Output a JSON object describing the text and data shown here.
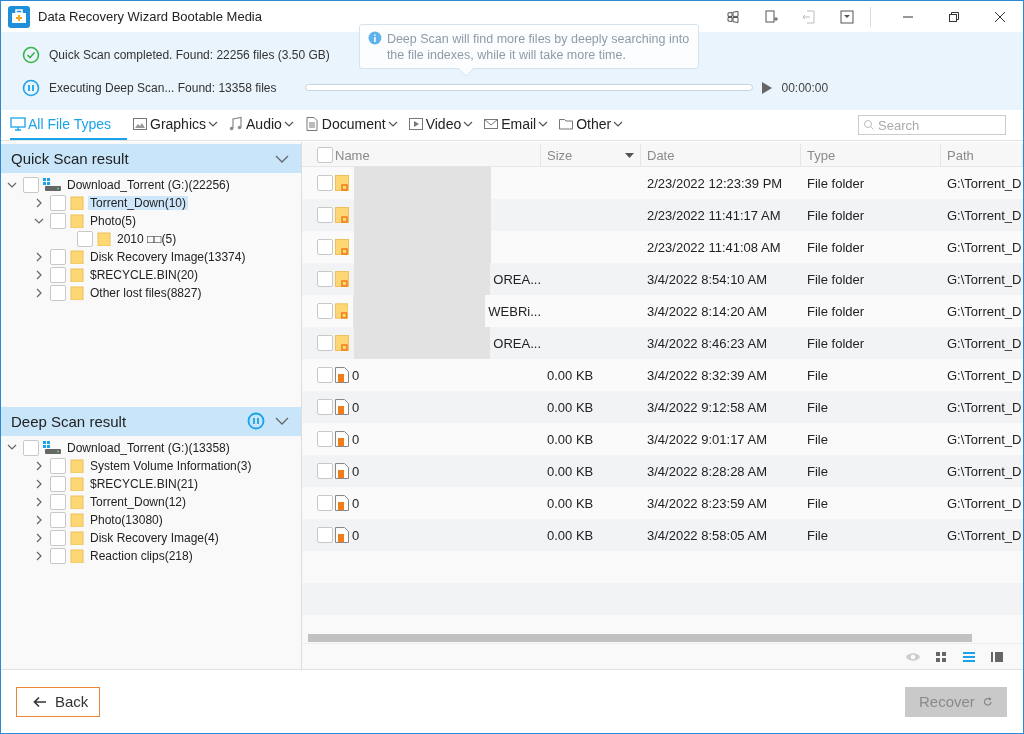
{
  "window": {
    "title": "Data Recovery Wizard Bootable Media"
  },
  "status": [
    {
      "kind": "done",
      "text": "Quick Scan completed.  Found: 22256 files (3.50 GB)"
    },
    {
      "kind": "running",
      "text": "Executing Deep Scan... Found: 13358 files",
      "level": 0,
      "time": "00:00:00"
    }
  ],
  "tooltip": {
    "text": "Deep Scan will find more files by deeply searching into the file indexes, while it will take more time."
  },
  "file_types": [
    {
      "label": "All File Types",
      "selected": true,
      "menu": false
    },
    {
      "label": "Graphics",
      "selected": false,
      "menu": true
    },
    {
      "label": "Audio",
      "selected": false,
      "menu": true
    },
    {
      "label": "Document",
      "selected": false,
      "menu": true
    },
    {
      "label": "Video",
      "selected": false,
      "menu": true
    },
    {
      "label": "Email",
      "selected": false,
      "menu": true
    },
    {
      "label": "Other",
      "selected": false,
      "menu": true
    }
  ],
  "search": {
    "placeholder": "Search"
  },
  "quick_scan": {
    "title": "Quick Scan result",
    "running": false,
    "tree": [
      {
        "label": "Download_Torrent (G:)(22256)",
        "kind": "drive",
        "expanded": true,
        "checked": false,
        "selected": false,
        "children": [
          {
            "label": "Torrent_Down(10)",
            "kind": "folder",
            "expanded": false,
            "checked": false,
            "selected": true
          },
          {
            "label": "Photo(5)",
            "kind": "folder",
            "expanded": true,
            "checked": false,
            "selected": false,
            "children": [
              {
                "label": "2010 □□(5)",
                "kind": "folder",
                "leaf": true,
                "checked": false,
                "selected": false
              }
            ]
          },
          {
            "label": "Disk Recovery Image(13374)",
            "kind": "folder",
            "expanded": false,
            "checked": false,
            "selected": false
          },
          {
            "label": "$RECYCLE.BIN(20)",
            "kind": "folder",
            "expanded": false,
            "checked": false,
            "selected": false
          },
          {
            "label": "Other lost files(8827)",
            "kind": "folder",
            "expanded": false,
            "checked": false,
            "selected": false
          }
        ]
      }
    ]
  },
  "deep_scan": {
    "title": "Deep Scan result",
    "running": true,
    "tree": [
      {
        "label": "Download_Torrent (G:)(13358)",
        "kind": "drive",
        "expanded": true,
        "checked": false,
        "selected": false,
        "children": [
          {
            "label": "System Volume Information(3)",
            "kind": "folder",
            "expanded": false,
            "checked": false,
            "selected": false
          },
          {
            "label": "$RECYCLE.BIN(21)",
            "kind": "folder",
            "expanded": false,
            "checked": false,
            "selected": false
          },
          {
            "label": "Torrent_Down(12)",
            "kind": "folder",
            "expanded": false,
            "checked": false,
            "selected": false
          },
          {
            "label": "Photo(13080)",
            "kind": "folder",
            "expanded": false,
            "checked": false,
            "selected": false
          },
          {
            "label": "Disk Recovery Image(4)",
            "kind": "folder",
            "expanded": false,
            "checked": false,
            "selected": false
          },
          {
            "label": "Reaction clips(218)",
            "kind": "folder",
            "expanded": false,
            "checked": false,
            "selected": false
          }
        ]
      }
    ]
  },
  "table": {
    "select_all": {
      "checked": false
    },
    "columns": [
      {
        "label": "Name",
        "sorted": false
      },
      {
        "label": "Size",
        "sorted": true
      },
      {
        "label": "Date",
        "sorted": false
      },
      {
        "label": "Type",
        "sorted": false
      },
      {
        "label": "Path",
        "sorted": false
      }
    ],
    "rows": [
      {
        "kind": "folder",
        "redacted": true,
        "checked": false,
        "date": "2/23/2022 12:23:39 PM",
        "type": "File folder",
        "path": "G:\\Torrent_D"
      },
      {
        "kind": "folder",
        "redacted": true,
        "checked": false,
        "date": "2/23/2022 11:41:17 AM",
        "type": "File folder",
        "path": "G:\\Torrent_D"
      },
      {
        "kind": "folder",
        "redacted": true,
        "checked": false,
        "date": "2/23/2022 11:41:08 AM",
        "type": "File folder",
        "path": "G:\\Torrent_D"
      },
      {
        "kind": "folder",
        "redacted": true,
        "checked": false,
        "name": "OREA...",
        "date": "3/4/2022 8:54:10 AM",
        "type": "File folder",
        "path": "G:\\Torrent_D"
      },
      {
        "kind": "folder",
        "redacted": true,
        "checked": false,
        "name": "WEBRi...",
        "date": "3/4/2022 8:14:20 AM",
        "type": "File folder",
        "path": "G:\\Torrent_D"
      },
      {
        "kind": "folder",
        "redacted": true,
        "checked": false,
        "name": "OREA...",
        "date": "3/4/2022 8:46:23 AM",
        "type": "File folder",
        "path": "G:\\Torrent_D"
      },
      {
        "kind": "file",
        "redacted": false,
        "checked": false,
        "name": "0",
        "size": "0.00 KB",
        "date": "3/4/2022 8:32:39 AM",
        "type": "File",
        "path": "G:\\Torrent_D"
      },
      {
        "kind": "file",
        "redacted": false,
        "checked": false,
        "name": "0",
        "size": "0.00 KB",
        "date": "3/4/2022 9:12:58 AM",
        "type": "File",
        "path": "G:\\Torrent_D"
      },
      {
        "kind": "file",
        "redacted": false,
        "checked": false,
        "name": "0",
        "size": "0.00 KB",
        "date": "3/4/2022 9:01:17 AM",
        "type": "File",
        "path": "G:\\Torrent_D"
      },
      {
        "kind": "file",
        "redacted": false,
        "checked": false,
        "name": "0",
        "size": "0.00 KB",
        "date": "3/4/2022 8:28:28 AM",
        "type": "File",
        "path": "G:\\Torrent_D"
      },
      {
        "kind": "file",
        "redacted": false,
        "checked": false,
        "name": "0",
        "size": "0.00 KB",
        "date": "3/4/2022 8:23:59 AM",
        "type": "File",
        "path": "G:\\Torrent_D"
      },
      {
        "kind": "file",
        "redacted": false,
        "checked": false,
        "name": "0",
        "size": "0.00 KB",
        "date": "3/4/2022 8:58:05 AM",
        "type": "File",
        "path": "G:\\Torrent_D"
      }
    ]
  },
  "views": [
    {
      "selected": false
    },
    {
      "selected": false
    },
    {
      "selected": true
    },
    {
      "selected": false
    }
  ],
  "footer": {
    "back": "Back",
    "recover": {
      "label": "Recover",
      "disabled": true
    }
  }
}
